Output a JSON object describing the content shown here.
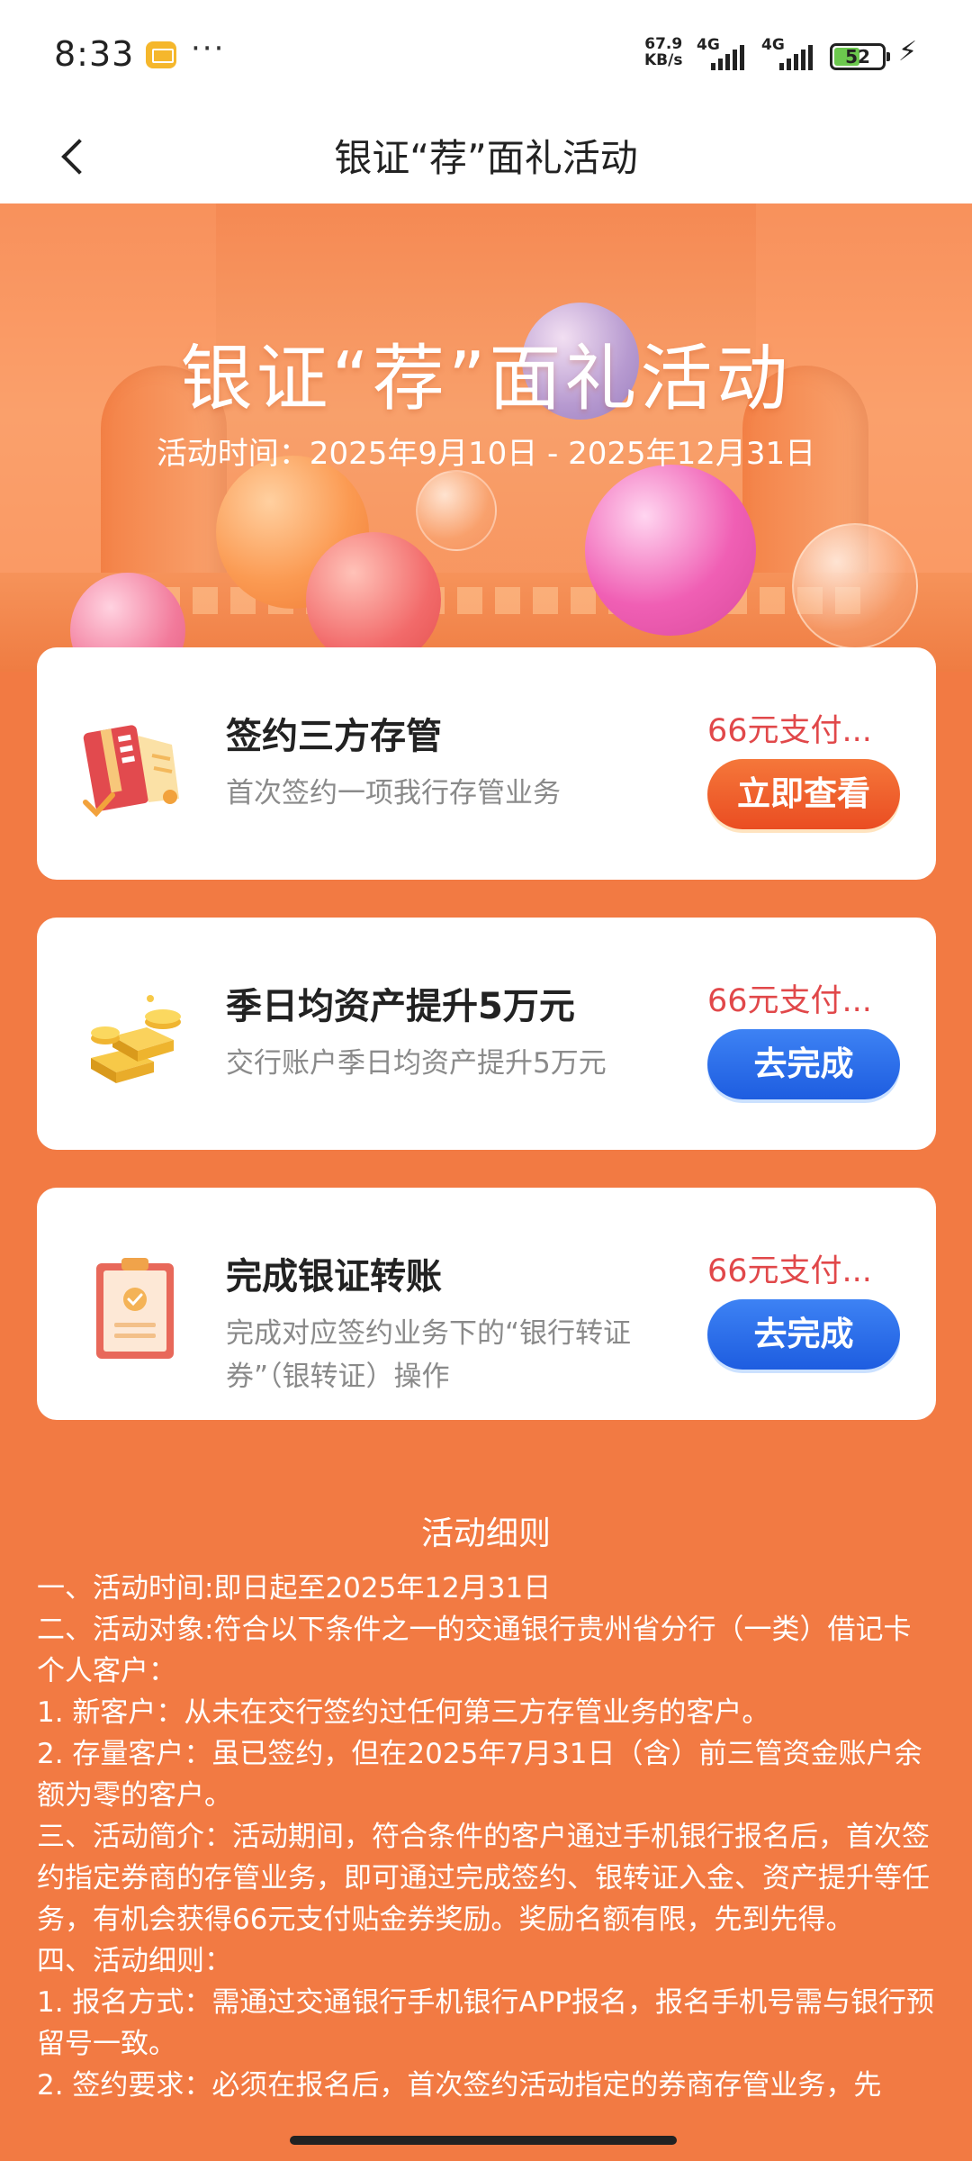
{
  "status_bar": {
    "time": "8:33",
    "more": "···",
    "net_speed_value": "67.9",
    "net_speed_unit": "KB/s",
    "network_1": "4G",
    "network_2": "4G",
    "battery": "52"
  },
  "nav": {
    "title": "银证“荐”面礼活动"
  },
  "hero": {
    "title": "银证“荐”面礼活动",
    "time": "活动时间：2025年9月10日 - 2025年12月31日"
  },
  "tasks": [
    {
      "icon": "card-sign-icon",
      "title": "签约三方存管",
      "desc": "首次签约一项我行存管业务",
      "reward": "66元支付...",
      "button": "立即查看",
      "button_color": "#ea4d22"
    },
    {
      "icon": "gold-bars-icon",
      "title": "季日均资产提升5万元",
      "desc": "交行账户季日均资产提升5万元",
      "reward": "66元支付...",
      "button": "去完成",
      "button_color": "#1e5de0"
    },
    {
      "icon": "clipboard-check-icon",
      "title": "完成银证转账",
      "desc": "完成对应签约业务下的“银行转证券”（银转证）操作",
      "reward": "66元支付...",
      "button": "去完成",
      "button_color": "#1e5de0"
    }
  ],
  "rules": {
    "heading": "活动细则",
    "lines": [
      "一、活动时间:即日起至2025年12月31日",
      "二、活动对象:符合以下条件之一的交通银行贵州省分行（一类）借记卡个人客户：",
      "1. 新客户：从未在交行签约过任何第三方存管业务的客户。",
      "2. 存量客户：虽已签约，但在2025年7月31日（含）前三管资金账户余额为零的客户。",
      "三、活动简介：活动期间，符合条件的客户通过手机银行报名后，首次签约指定券商的存管业务，即可通过完成签约、银转证入金、资产提升等任务，有机会获得66元支付贴金券奖励。奖励名额有限，先到先得。",
      "四、活动细则：",
      "1. 报名方式：需通过交通银行手机银行APP报名，报名手机号需与银行预留号一致。",
      "2. 签约要求：必须在报名后，首次签约活动指定的券商存管业务，先"
    ]
  },
  "colors": {
    "page_bg": "#f27a43",
    "reward_text": "#e1484a",
    "accent_orange": "#ea4d22",
    "accent_blue": "#1e5de0"
  }
}
